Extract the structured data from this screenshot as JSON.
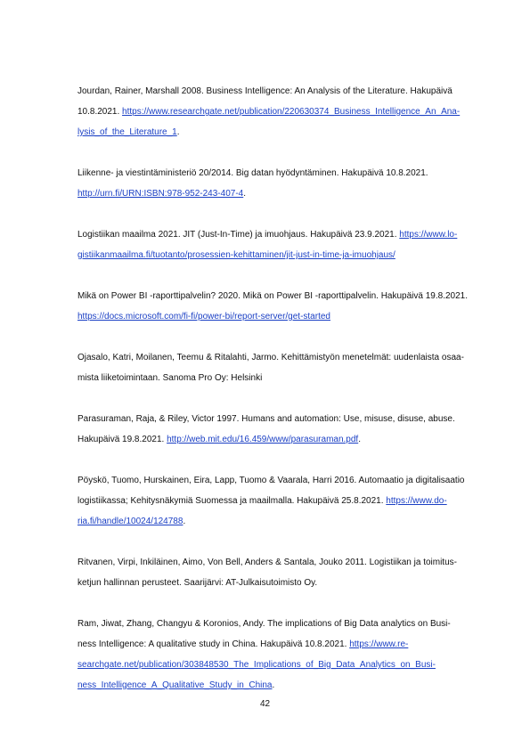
{
  "references": [
    {
      "lines": [
        {
          "text": "Jourdan, Rainer, Marshall 2008. Business Intelligence: An Analysis of the Literature. Hakupäivä"
        },
        {
          "text": "10.8.2021. ",
          "link": "https://www.researchgate.net/publication/220630374_Business_Intelligence_An_Ana-"
        },
        {
          "text": "",
          "link": "lysis_of_the_Literature_1",
          "after": "."
        }
      ]
    },
    {
      "lines": [
        {
          "text": "Liikenne- ja viestintäministeriö 20/2014. Big datan hyödyntäminen. Hakupäivä 10.8.2021."
        },
        {
          "text": "",
          "link": "http://urn.fi/URN:ISBN:978-952-243-407-4",
          "after": "."
        }
      ]
    },
    {
      "lines": [
        {
          "text": "Logistiikan maailma 2021. JIT (Just-In-Time) ja imuohjaus. Hakupäivä 23.9.2021. ",
          "link": "https://www.lo-"
        },
        {
          "text": "",
          "link": "gistiikanmaailma.fi/tuotanto/prosessien-kehittaminen/jit-just-in-time-ja-imuohjaus/"
        }
      ]
    },
    {
      "lines": [
        {
          "text": "Mikä on Power BI -raporttipalvelin? 2020. Mikä on Power BI -raporttipalvelin. Hakupäivä 19.8.2021."
        },
        {
          "text": "",
          "link": "https://docs.microsoft.com/fi-fi/power-bi/report-server/get-started"
        }
      ]
    },
    {
      "lines": [
        {
          "text": "Ojasalo, Katri, Moilanen, Teemu & Ritalahti, Jarmo. Kehittämistyön menetelmät: uudenlaista osaa-"
        },
        {
          "text": "mista liiketoimintaan. Sanoma Pro Oy: Helsinki"
        }
      ]
    },
    {
      "lines": [
        {
          "text": "Parasuraman, Raja, & Riley, Victor 1997. Humans and automation: Use, misuse, disuse, abuse."
        },
        {
          "text": "Hakupäivä 19.8.2021. ",
          "link": "http://web.mit.edu/16.459/www/parasuraman.pdf",
          "after": "."
        }
      ]
    },
    {
      "lines": [
        {
          "text": "Pöyskö, Tuomo, Hurskainen, Eira, Lapp, Tuomo & Vaarala, Harri 2016. Automaatio ja digitalisaatio"
        },
        {
          "text": "logistiikassa; Kehitysnäkymiä Suomessa ja maailmalla. Hakupäivä 25.8.2021. ",
          "link": "https://www.do-"
        },
        {
          "text": "",
          "link": "ria.fi/handle/10024/124788",
          "after": "."
        }
      ]
    },
    {
      "lines": [
        {
          "text": "Ritvanen, Virpi, Inkiläinen, Aimo, Von Bell, Anders & Santala, Jouko 2011. Logistiikan ja toimitus-"
        },
        {
          "text": "ketjun hallinnan perusteet. Saarijärvi: AT-Julkaisutoimisto Oy."
        }
      ]
    },
    {
      "lines": [
        {
          "text": "Ram, Jiwat, Zhang, Changyu & Koronios, Andy. The implications of Big Data analytics on Busi-"
        },
        {
          "text": "ness Intelligence: A qualitative study in China. Hakupäivä 10.8.2021. ",
          "link": "https://www.re-"
        },
        {
          "text": "",
          "link": "searchgate.net/publication/303848530_The_Implications_of_Big_Data_Analytics_on_Busi-"
        },
        {
          "text": "",
          "link": "ness_Intelligence_A_Qualitative_Study_in_China",
          "after": "."
        }
      ]
    }
  ],
  "page_number": "42"
}
